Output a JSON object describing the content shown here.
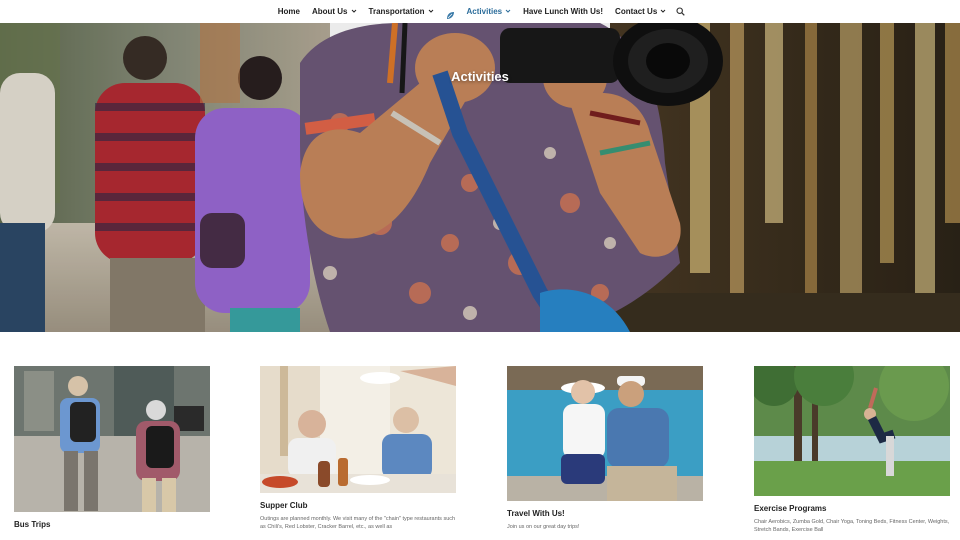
{
  "nav": {
    "items": [
      {
        "label": "Home",
        "dropdown": false
      },
      {
        "label": "About Us",
        "dropdown": true
      },
      {
        "label": "Transportation",
        "dropdown": true
      },
      {
        "label": "Activities",
        "dropdown": true,
        "active": true
      },
      {
        "label": "Have Lunch With Us!",
        "dropdown": false
      },
      {
        "label": "Contact Us",
        "dropdown": true
      }
    ],
    "search_icon": "search-icon",
    "logo_icon": "leaf-logo-icon",
    "active_color": "#2b6c9a"
  },
  "hero": {
    "title": "Activities"
  },
  "cards": [
    {
      "title": "Bus Trips",
      "text": ""
    },
    {
      "title": "Supper Club",
      "text": "Outings are planned monthly. We visit many of the \"chain\" type restaurants such as Chili's, Red Lobster, Cracker Barrel, etc., as well as"
    },
    {
      "title": "Travel With Us!",
      "text": "Join us on our great day trips!"
    },
    {
      "title": "Exercise Programs",
      "text": "Chair Aerobics, Zumba Gold, Chair Yoga, Toning Beds, Fitness Center, Weights, Stretch Bands, Exercise Ball"
    }
  ]
}
